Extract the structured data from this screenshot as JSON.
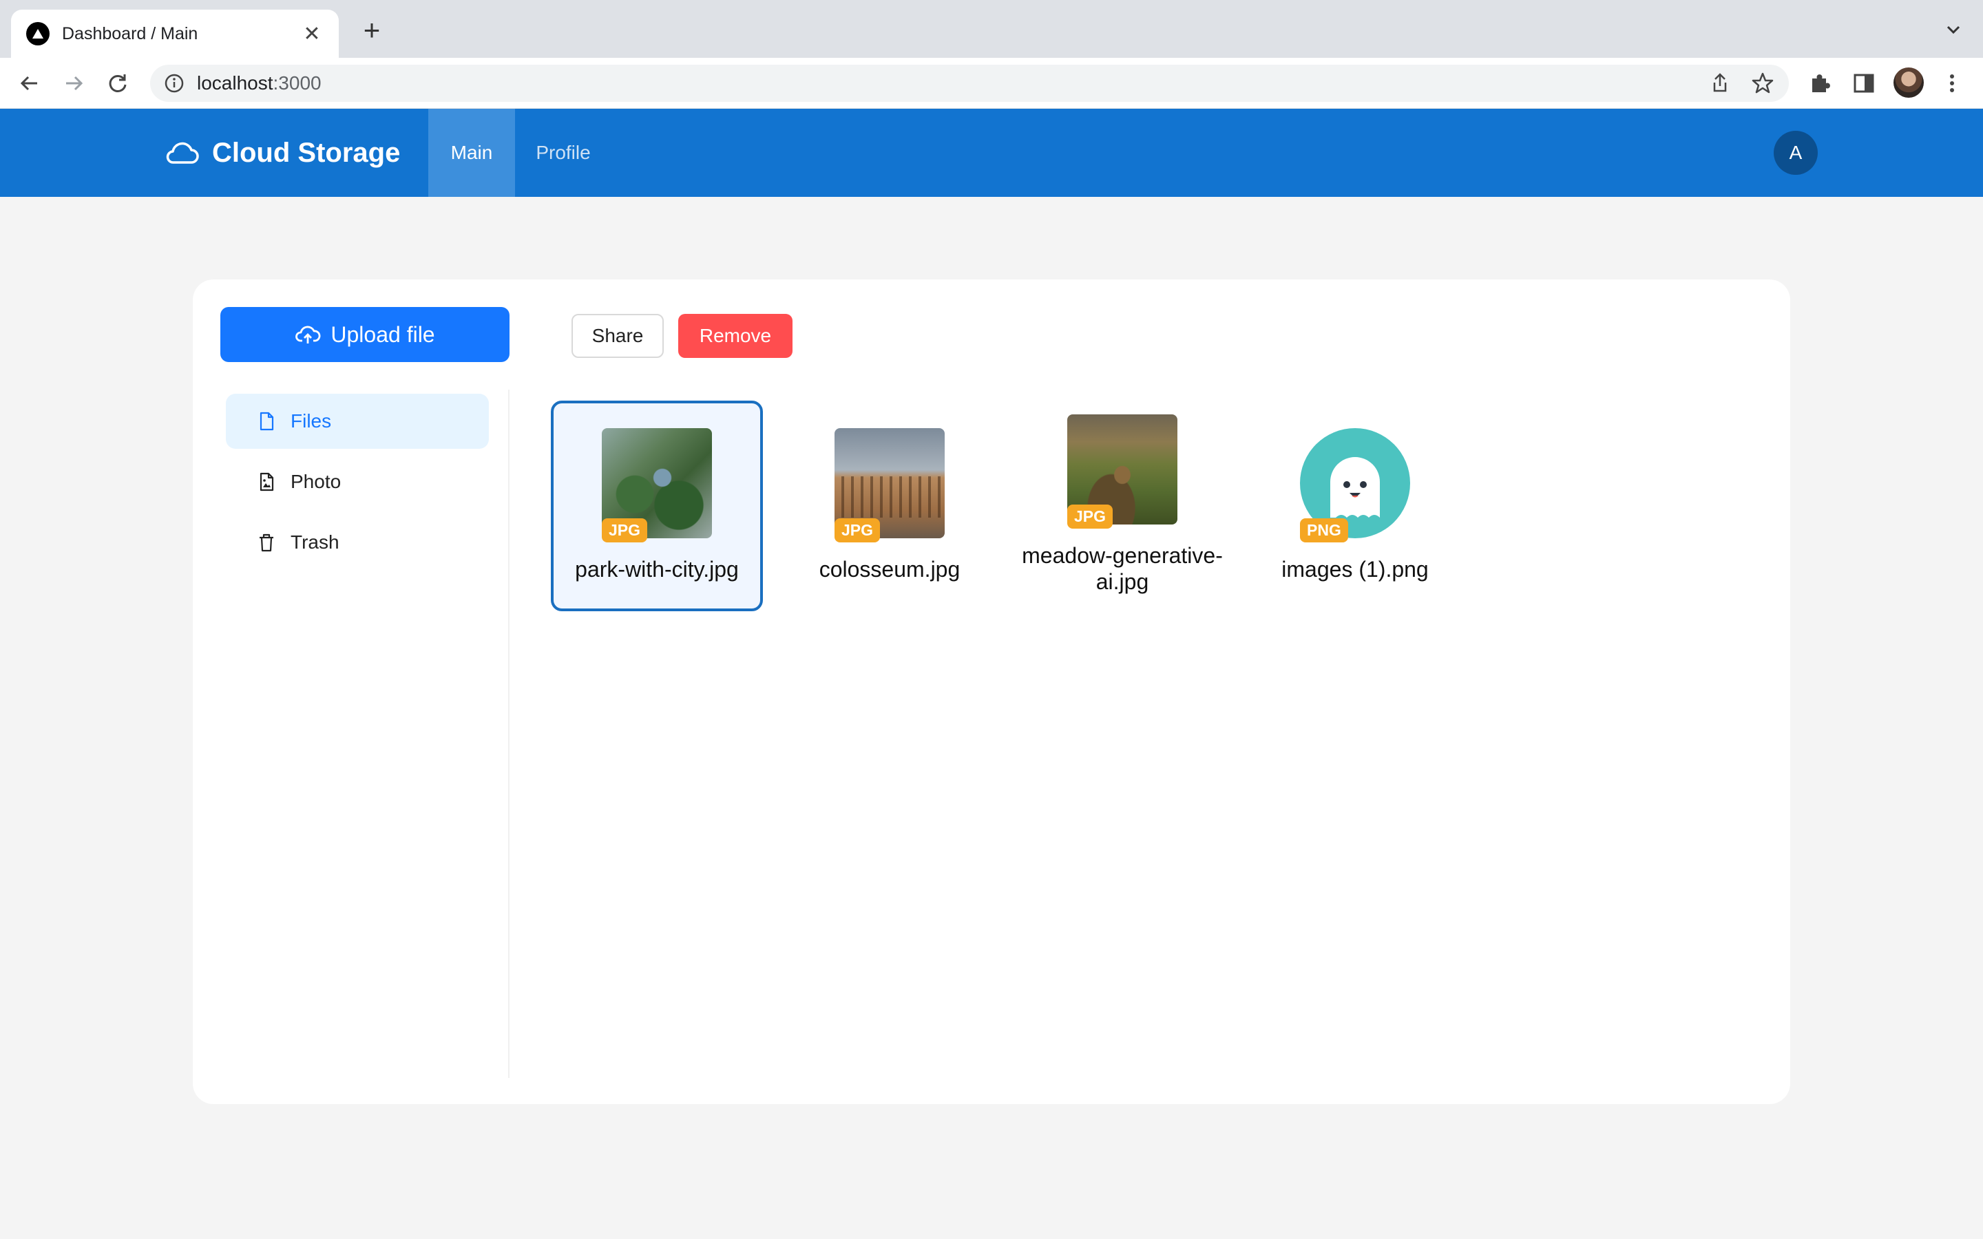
{
  "browser": {
    "tab_title": "Dashboard / Main",
    "tab_close": "✕",
    "new_tab": "+",
    "url_host": "localhost",
    "url_port": ":3000"
  },
  "header": {
    "brand": "Cloud Storage",
    "nav": [
      {
        "label": "Main",
        "active": true
      },
      {
        "label": "Profile",
        "active": false
      }
    ],
    "avatar_initial": "A",
    "color": "#1274d0"
  },
  "toolbar": {
    "upload_label": "Upload file",
    "share_label": "Share",
    "remove_label": "Remove"
  },
  "sidebar": {
    "items": [
      {
        "label": "Files",
        "icon": "file-icon",
        "active": true
      },
      {
        "label": "Photo",
        "icon": "photo-file-icon",
        "active": false
      },
      {
        "label": "Trash",
        "icon": "trash-icon",
        "active": false
      }
    ]
  },
  "files": [
    {
      "name": "park-with-city.jpg",
      "type": "JPG",
      "selected": true
    },
    {
      "name": "colosseum.jpg",
      "type": "JPG",
      "selected": false
    },
    {
      "name": "meadow-generative-ai.jpg",
      "type": "JPG",
      "selected": false
    },
    {
      "name": "images (1).png",
      "type": "PNG",
      "selected": false
    }
  ]
}
